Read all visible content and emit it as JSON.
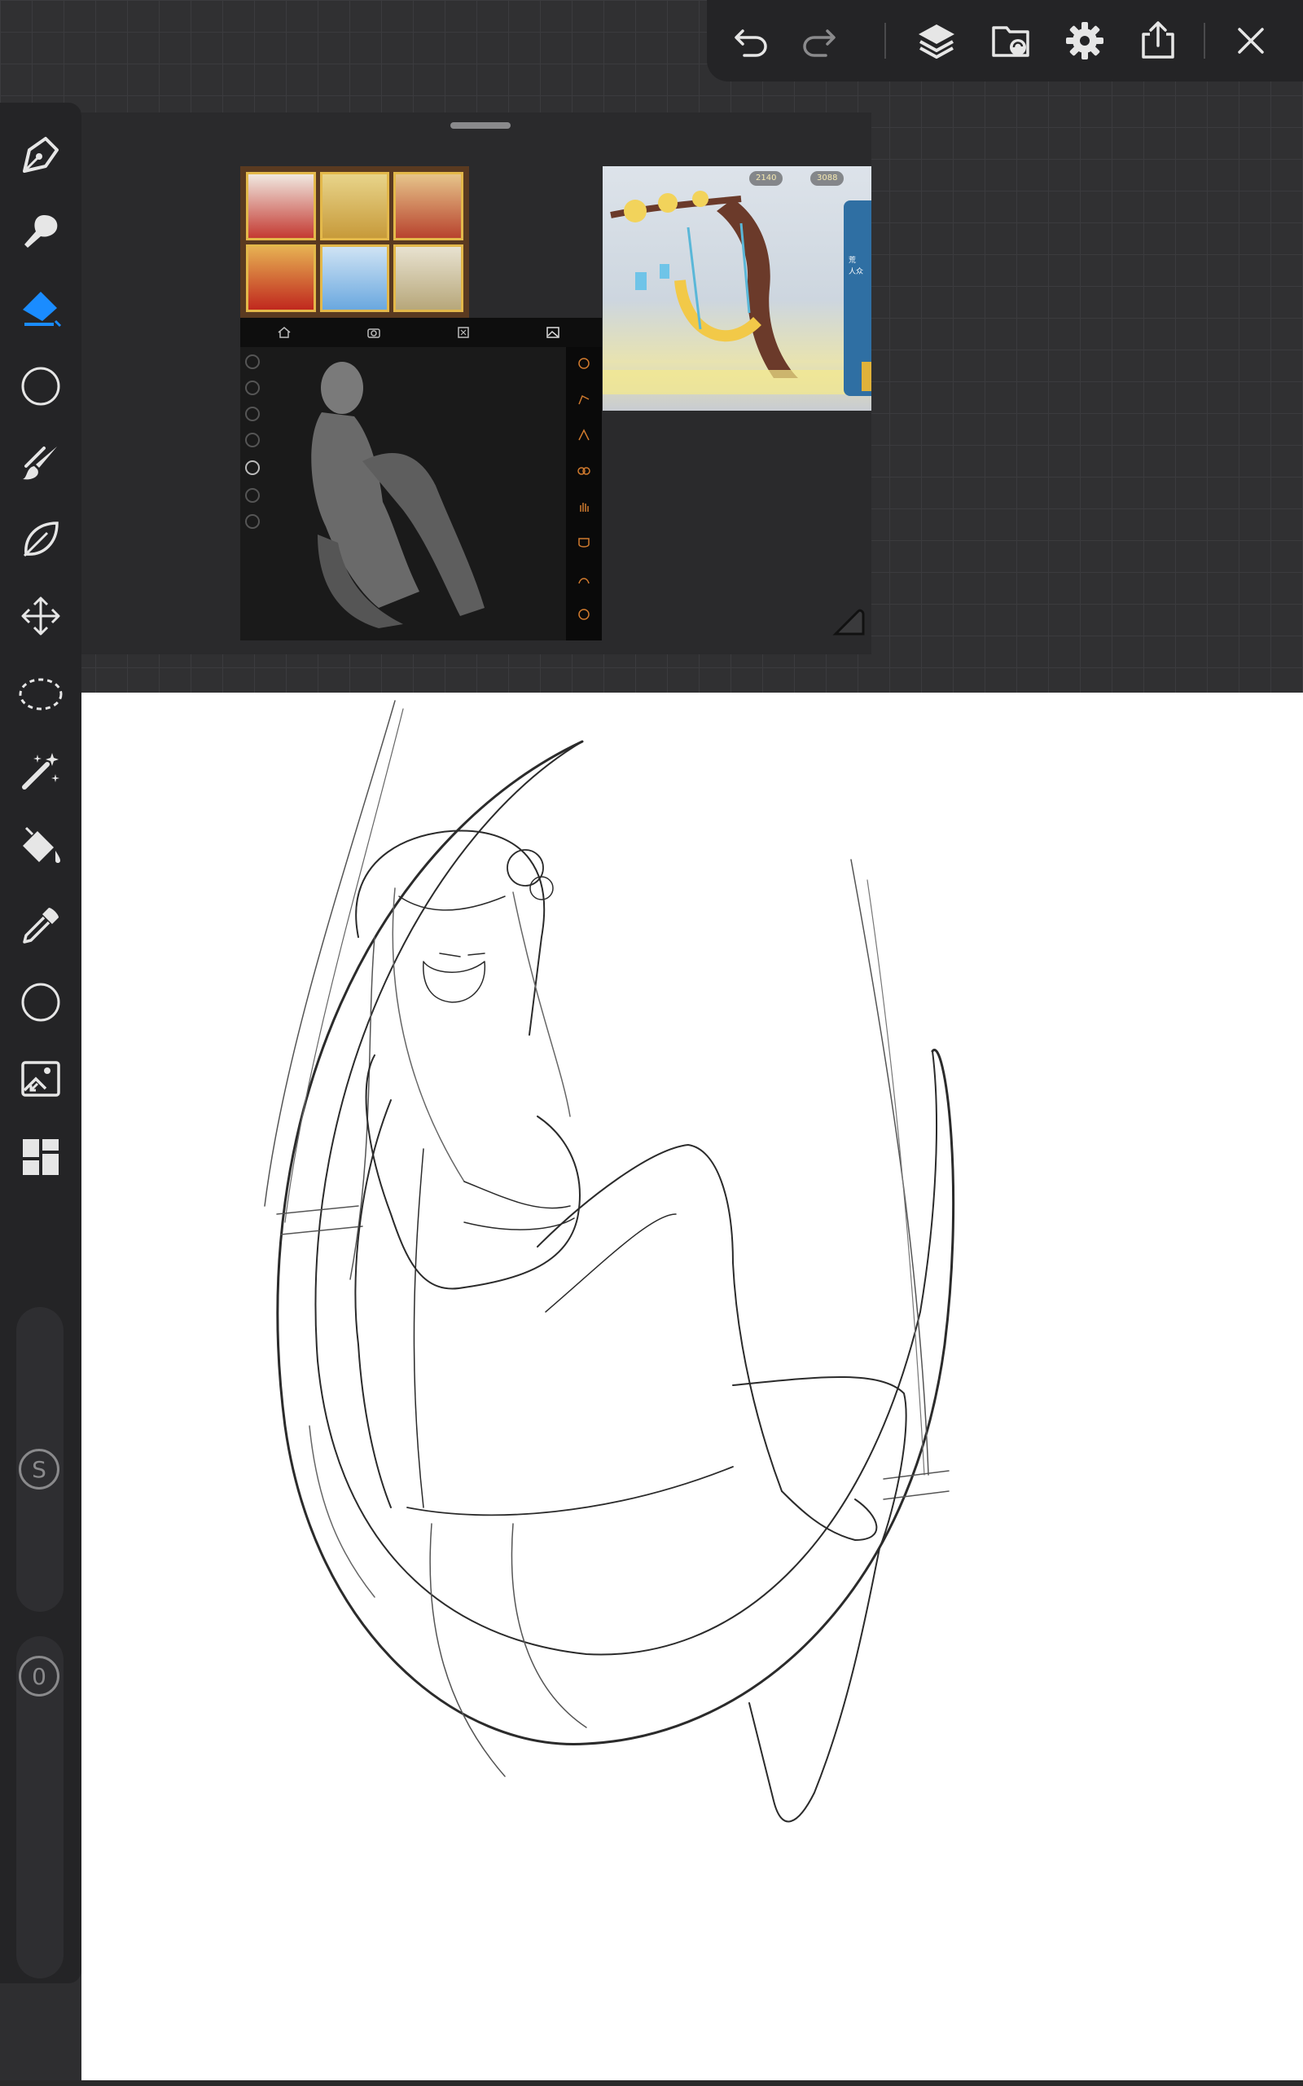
{
  "app": {
    "name": "Procreate-style drawing app"
  },
  "colors": {
    "accent": "#1a8cff",
    "toolbar_bg": "#242426",
    "icon": "#e6e6e6",
    "icon_disabled": "#8a8a8c",
    "canvas": "#ffffff"
  },
  "top_toolbar": {
    "buttons": [
      {
        "name": "undo-icon",
        "enabled": true
      },
      {
        "name": "redo-icon",
        "enabled": false
      },
      {
        "name": "layers-icon",
        "enabled": true
      },
      {
        "name": "folder-sync-icon",
        "enabled": true
      },
      {
        "name": "gear-icon",
        "enabled": true
      },
      {
        "name": "share-icon",
        "enabled": true
      },
      {
        "name": "close-icon",
        "enabled": true
      }
    ]
  },
  "left_toolbar": {
    "tools": [
      {
        "name": "pen-icon",
        "active": false
      },
      {
        "name": "smudge-icon",
        "active": false
      },
      {
        "name": "eraser-icon",
        "active": true
      },
      {
        "name": "circle-icon",
        "active": false
      },
      {
        "name": "brush-icon",
        "active": false
      },
      {
        "name": "leaf-icon",
        "active": false
      },
      {
        "name": "move-icon",
        "active": false
      },
      {
        "name": "lasso-icon",
        "active": false
      },
      {
        "name": "magic-wand-icon",
        "active": false
      },
      {
        "name": "paint-bucket-icon",
        "active": false
      },
      {
        "name": "eyedropper-icon",
        "active": false
      },
      {
        "name": "color-circle-icon",
        "active": false
      },
      {
        "name": "image-import-icon",
        "active": false
      },
      {
        "name": "grid-layout-icon",
        "active": false
      }
    ],
    "size_slider": {
      "label": "S"
    },
    "opacity_slider": {
      "label": "0"
    }
  },
  "reference_window": {
    "thumb_grid": {
      "cells": [
        "character-red-white-hair",
        "character-gold-outfit",
        "character-red-dress",
        "character-red-gown",
        "character-white-blue-pet",
        "character-white-cat"
      ]
    },
    "pose_app": {
      "top_icons": [
        "home-icon",
        "camera-icon",
        "screenshot-icon",
        "image-icon"
      ],
      "right_icons": [
        "pose-icon-1",
        "pose-icon-2",
        "pose-icon-3",
        "pose-icon-4",
        "hand-icon",
        "face-icon",
        "hair-icon",
        "head-icon"
      ]
    },
    "game_screenshot": {
      "coin_a": "2140",
      "coin_b": "3088",
      "side_text_1": "荒",
      "side_text_2": "人众"
    }
  }
}
